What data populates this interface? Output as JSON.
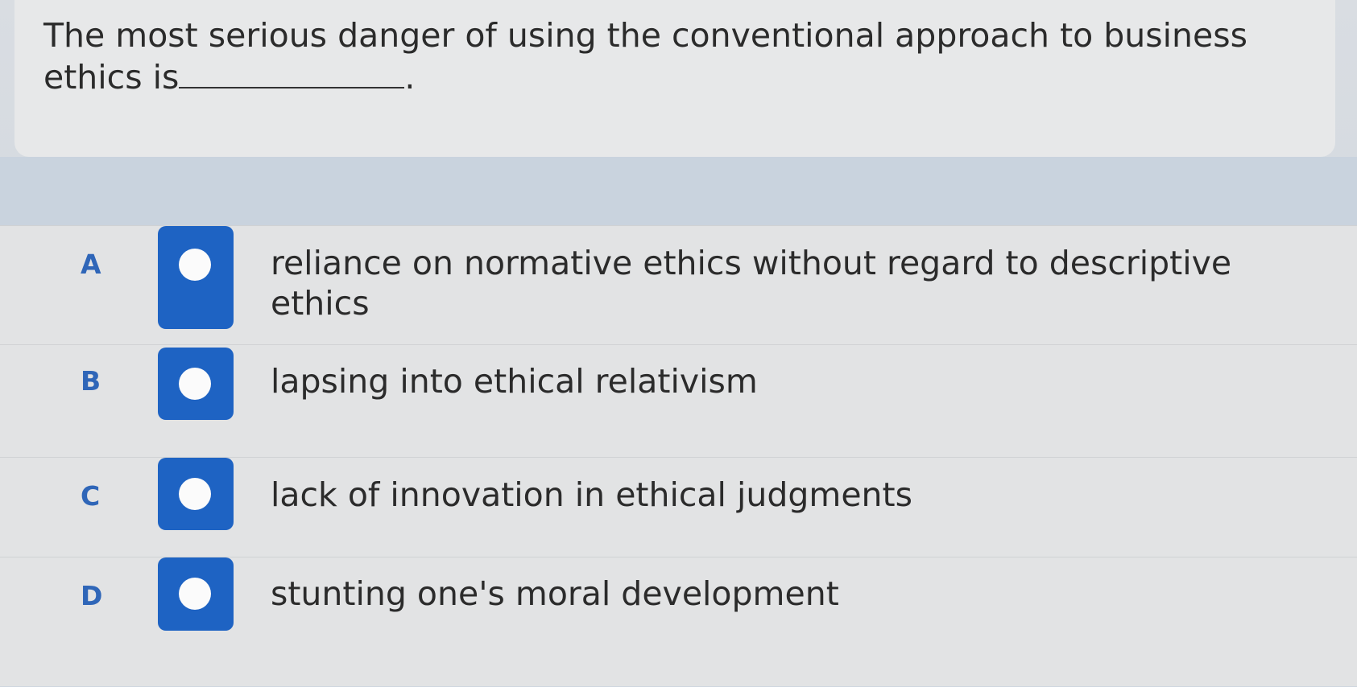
{
  "question": {
    "text": "The most serious danger of using the conventional approach to business ethics is",
    "suffix": "."
  },
  "options": [
    {
      "letter": "A",
      "text": "reliance on normative ethics without regard to descriptive ethics",
      "selected": false
    },
    {
      "letter": "B",
      "text": "lapsing into ethical relativism",
      "selected": false
    },
    {
      "letter": "C",
      "text": "lack of innovation in ethical judgments",
      "selected": false
    },
    {
      "letter": "D",
      "text": "stunting one's moral development",
      "selected": false
    }
  ],
  "colors": {
    "radio": "#1e63c3",
    "letter": "#2f66b8"
  }
}
